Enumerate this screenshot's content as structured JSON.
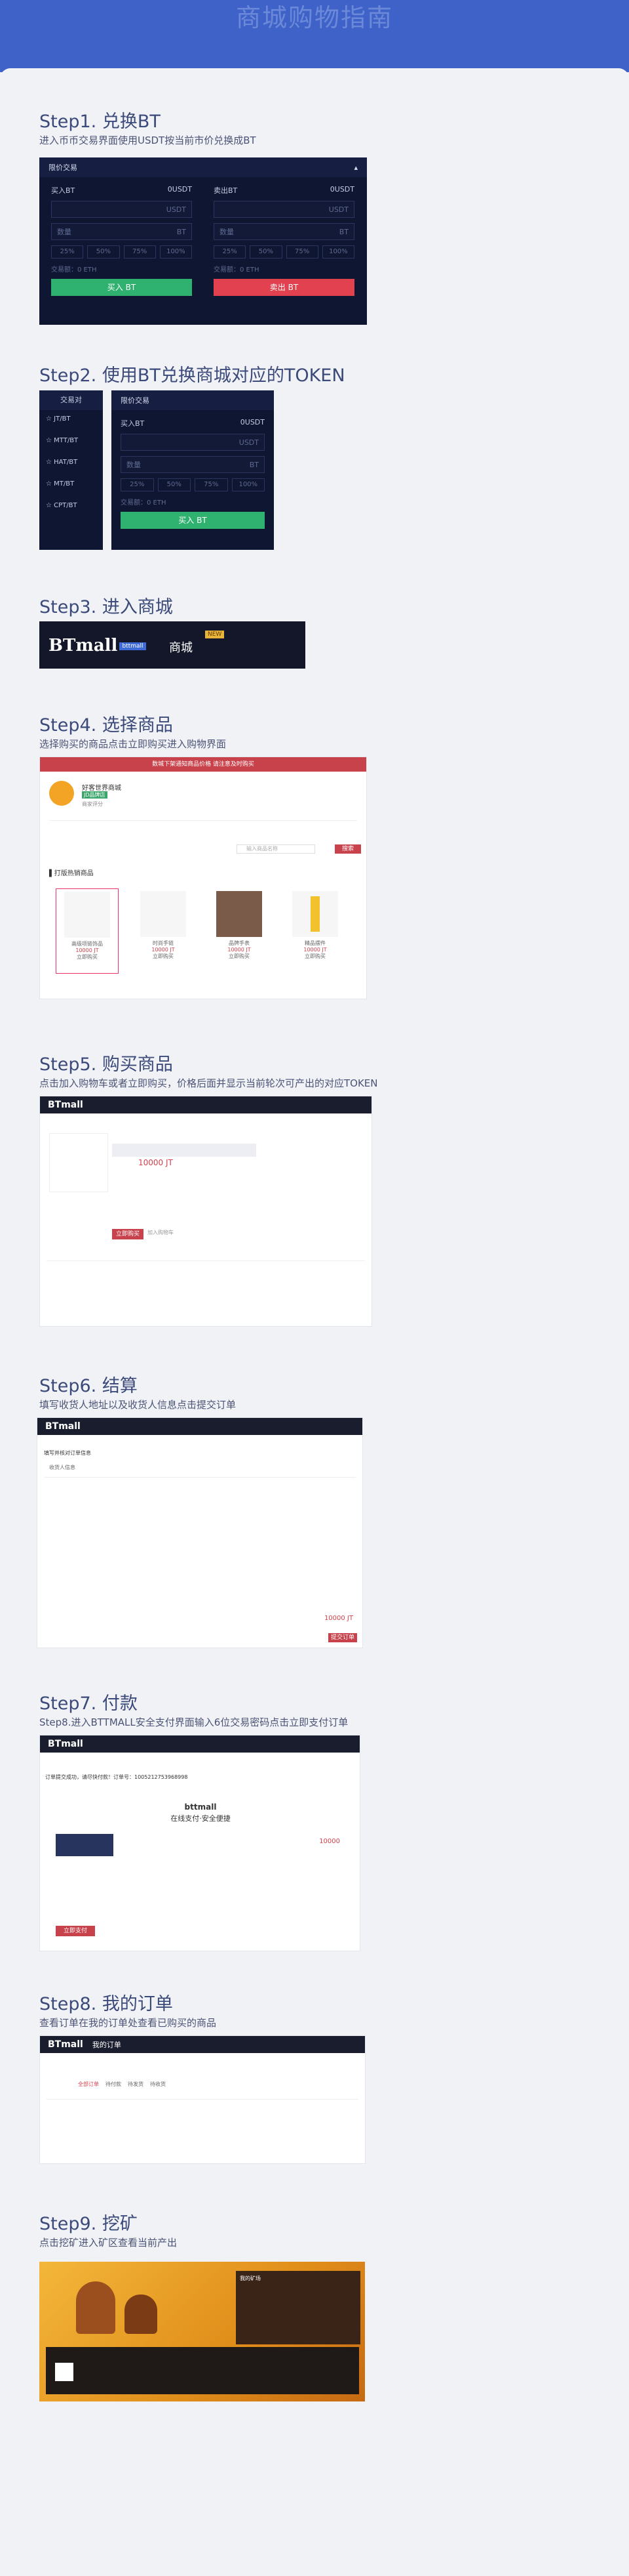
{
  "page": {
    "title": "商城购物指南"
  },
  "steps": [
    {
      "title": "Step1.   兑换BT",
      "desc": "进入币币交易界面使用USDT按当前市价兑换成BT"
    },
    {
      "title": "Step2.  使用BT兑换商城对应的TOKEN",
      "desc": ""
    },
    {
      "title": "Step3. 进入商城",
      "desc": ""
    },
    {
      "title": "Step4.   选择商品",
      "desc": "选择购买的商品点击立即购买进入购物界面"
    },
    {
      "title": "Step5.   购买商品",
      "desc": "点击加入购物车或者立即购买，价格后面并显示当前轮次可产出的对应TOKEN"
    },
    {
      "title": "Step6.   结算",
      "desc": "填写收货人地址以及收货人信息点击提交订单"
    },
    {
      "title": "Step7.   付款",
      "desc": "Step8.进入BTTMALL安全支付界面输入6位交易密码点击立即支付订单"
    },
    {
      "title": "Step8.   我的订单",
      "desc": "查看订单在我的订单处查看已购买的商品"
    },
    {
      "title": "Step9.   挖矿",
      "desc": "点击挖矿进入矿区查看当前产出"
    }
  ],
  "trade1": {
    "tab": "限价交易",
    "buy_label": "买入BT",
    "buy_price": "0USDT",
    "sell_label": "卖出BT",
    "sell_price": "0USDT",
    "unit_usdt": "USDT",
    "unit_bt": "BT",
    "qty_placeholder": "数量",
    "percents": [
      "25%",
      "50%",
      "75%",
      "100%"
    ],
    "volume": "交易额：0 ETH",
    "buy_btn": "买入 BT",
    "sell_btn": "卖出 BT"
  },
  "trade2": {
    "side_title": "交易对",
    "pairs": [
      "JT/BT",
      "MTT/BT",
      "HAT/BT",
      "MT/BT",
      "CPT/BT"
    ],
    "tab": "限价交易",
    "buy_label": "买入BT",
    "buy_price": "0USDT",
    "unit_usdt": "USDT",
    "unit_bt": "BT",
    "qty_placeholder": "数量",
    "percents": [
      "25%",
      "50%",
      "75%",
      "100%"
    ],
    "volume": "交易额：0 ETH",
    "buy_btn": "买入 BT"
  },
  "mall_banner": {
    "logo": "BTmall",
    "logo_tag": "bttmall",
    "label": "商城",
    "badge": "NEW"
  },
  "shop": {
    "notice": "数城下架通知商品价格     请注意及时购买",
    "store_name": "好客世界商城",
    "store_badge": "JD品牌店",
    "store_rate": "商家评分",
    "products_title": "打版热销商品",
    "search_placeholder": "输入商品名称",
    "search_btn": "搜索",
    "price": "10000 JT",
    "items": [
      "高级项链饰品",
      "时尚手链",
      "品牌手表",
      "精品摆件"
    ],
    "buy": "立即购买"
  },
  "buy": {
    "logo": "BTmall",
    "price": "10000 JT",
    "btn_buy": "立即购买",
    "btn_cart": "加入购物车"
  },
  "checkout": {
    "logo": "BTmall",
    "heading": "填写并核对订单信息",
    "section_addr": "收货人信息",
    "total": "10000 JT",
    "submit": "提交订单"
  },
  "pay": {
    "logo": "BTmall",
    "order_msg": "订单提交成功，请尽快付款！订单号：1005212753968998",
    "title": "bttmall",
    "subtitle": "在线支付·安全便捷",
    "amount": "10000",
    "pay_btn": "立即支付"
  },
  "orders": {
    "logo": "BTmall",
    "nav": "我的订单",
    "tabs": [
      "全部订单",
      "待付款",
      "待发货",
      "待收货"
    ]
  },
  "mine": {
    "panel_title": "我的矿场"
  }
}
